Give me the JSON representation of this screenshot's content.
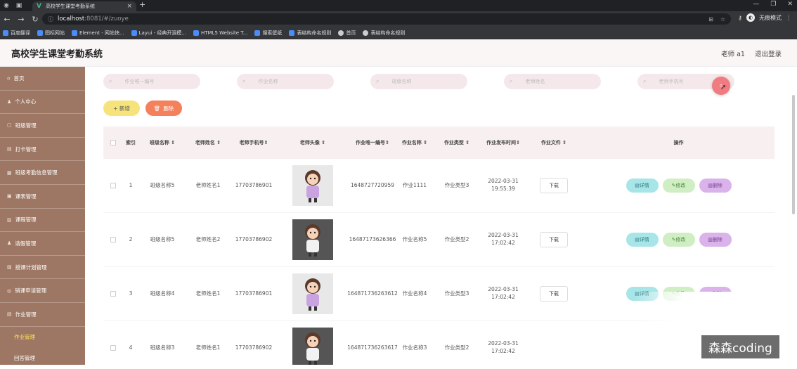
{
  "browser": {
    "tab_title": "高校学生课堂考勤系统",
    "url_host": "localhost",
    "url_rest": ":8081/#/zuoye",
    "profile_label": "无痕模式"
  },
  "bookmarks": [
    {
      "label": "百度翻译",
      "icon": "bookmark-icon"
    },
    {
      "label": "图标网站",
      "icon": "bookmark-icon"
    },
    {
      "label": "Element - 网站快...",
      "icon": "bookmark-icon"
    },
    {
      "label": "Layui - 经典开源模...",
      "icon": "bookmark-icon"
    },
    {
      "label": "HTML5 Website T...",
      "icon": "bookmark-icon"
    },
    {
      "label": "搜索壁纸",
      "icon": "bookmark-icon"
    },
    {
      "label": "表结构命名规则",
      "icon": "bookmark-icon"
    },
    {
      "label": "首页",
      "icon": "globe-icon"
    },
    {
      "label": "表结构命名规则",
      "icon": "globe-icon"
    }
  ],
  "header": {
    "app_title": "高校学生课堂考勤系统",
    "user": "老师 a1",
    "logout": "退出登录"
  },
  "sidebar": {
    "items": [
      {
        "label": "首页"
      },
      {
        "label": "个人中心"
      },
      {
        "label": "班级管理"
      },
      {
        "label": "打卡管理"
      },
      {
        "label": "班级考勤信息管理"
      },
      {
        "label": "课表管理"
      },
      {
        "label": "课程管理"
      },
      {
        "label": "请假管理"
      },
      {
        "label": "授课计划管理"
      },
      {
        "label": "销课申请管理"
      },
      {
        "label": "作业管理"
      }
    ],
    "subitems": [
      {
        "label": "作业管理",
        "active": true
      },
      {
        "label": "回答管理",
        "active": false
      }
    ]
  },
  "search": {
    "fields": [
      {
        "placeholder": "作业唯一编号"
      },
      {
        "placeholder": "作业名称"
      },
      {
        "placeholder": "班级名称"
      },
      {
        "placeholder": "老师姓名"
      },
      {
        "placeholder": "老师手机号"
      }
    ]
  },
  "actions": {
    "add": "+ 新增",
    "delete": "删除"
  },
  "table": {
    "headers": {
      "index": "索引",
      "class_name": "班级名称",
      "teacher_name": "老师姓名",
      "teacher_phone": "老师手机号",
      "teacher_avatar": "老师头像",
      "homework_id": "作业唯一编号",
      "homework_name": "作业名称",
      "homework_type": "作业类型",
      "publish_time": "作业发布时间",
      "homework_file": "作业文件",
      "operations": "操作"
    },
    "rows": [
      {
        "index": "1",
        "class_name": "班级名称5",
        "teacher_name": "老师姓名1",
        "teacher_phone": "17703786901",
        "homework_id": "1648727720959",
        "homework_name": "作业1111",
        "homework_type": "作业类型3",
        "publish_time": "2022-03-31 19:55:39",
        "download": "下载",
        "detail": "详情",
        "edit": "修改",
        "remove": "删除"
      },
      {
        "index": "2",
        "class_name": "班级名称5",
        "teacher_name": "老师姓名2",
        "teacher_phone": "17703786902",
        "homework_id": "16487173626366",
        "homework_name": "作业名称5",
        "homework_type": "作业类型2",
        "publish_time": "2022-03-31 17:02:42",
        "download": "下载",
        "detail": "详情",
        "edit": "修改",
        "remove": "删除"
      },
      {
        "index": "3",
        "class_name": "班级名称4",
        "teacher_name": "老师姓名1",
        "teacher_phone": "17703786901",
        "homework_id": "164871736263612",
        "homework_name": "作业名称4",
        "homework_type": "作业类型3",
        "publish_time": "2022-03-31 17:02:42",
        "download": "下载",
        "detail": "详情",
        "edit": "修改",
        "remove": "删除"
      },
      {
        "index": "4",
        "class_name": "班级名称3",
        "teacher_name": "老师姓名1",
        "teacher_phone": "17703786902",
        "homework_id": "164871736263617",
        "homework_name": "作业名称3",
        "homework_type": "作业类型2",
        "publish_time": "2022-03-31 17:02:42",
        "download": "",
        "detail": "",
        "edit": "",
        "remove": ""
      }
    ]
  },
  "watermark": "森森coding",
  "colors": {
    "sidebar_bg": "#9d7763",
    "active_sub": "#ffe35c",
    "search_btn": "#f07b80",
    "add_btn": "#f6e37c",
    "delete_btn": "#f4805c"
  }
}
